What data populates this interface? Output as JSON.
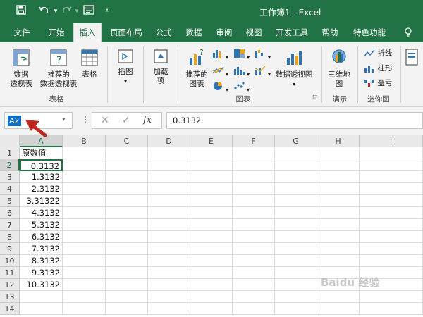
{
  "window": {
    "title": "工作簿1 - Excel"
  },
  "menu": {
    "tabs": [
      "文件",
      "开始",
      "插入",
      "页面布局",
      "公式",
      "数据",
      "审阅",
      "视图",
      "开发工具",
      "帮助",
      "特色功能"
    ],
    "active_tab": "插入",
    "lightbulb_icon": "lightbulb-icon"
  },
  "ribbon": {
    "pivottable_label": "数据\n透视表",
    "recommended_pivot_label": "推荐的\n数据透视表",
    "table_label": "表格",
    "group_tables": "表格",
    "illustrations_label": "插图",
    "addins_label": "加载\n项",
    "recommended_charts_label": "推荐的\n图表",
    "pivotchart_label": "数据透视图",
    "group_charts": "图表",
    "map3d_label": "三维地\n图",
    "group_tours": "演示",
    "sparkline_line": "折线",
    "sparkline_column": "柱形",
    "sparkline_winloss": "盈亏",
    "group_sparklines": "迷你图"
  },
  "formula_bar": {
    "name_box": "A2",
    "fx_label": "fx",
    "value": "0.3132"
  },
  "sheet": {
    "columns": [
      "A",
      "B",
      "C",
      "D",
      "E",
      "F",
      "G",
      "H",
      "I"
    ],
    "rows": [
      "1",
      "2",
      "3",
      "4",
      "5",
      "6",
      "7",
      "8",
      "9",
      "10",
      "11",
      "12",
      "13",
      "14"
    ],
    "a_column": [
      "原数值",
      "0.3132",
      "1.3132",
      "2.3132",
      "3.31322",
      "4.3132",
      "5.3132",
      "6.3132",
      "7.3132",
      "8.3132",
      "9.3132",
      "10.3132",
      "",
      ""
    ],
    "active_cell": "A2"
  },
  "watermark": "Baidu 经验",
  "colors": {
    "brand_green": "#217346",
    "arrow_red": "#c0261d"
  }
}
